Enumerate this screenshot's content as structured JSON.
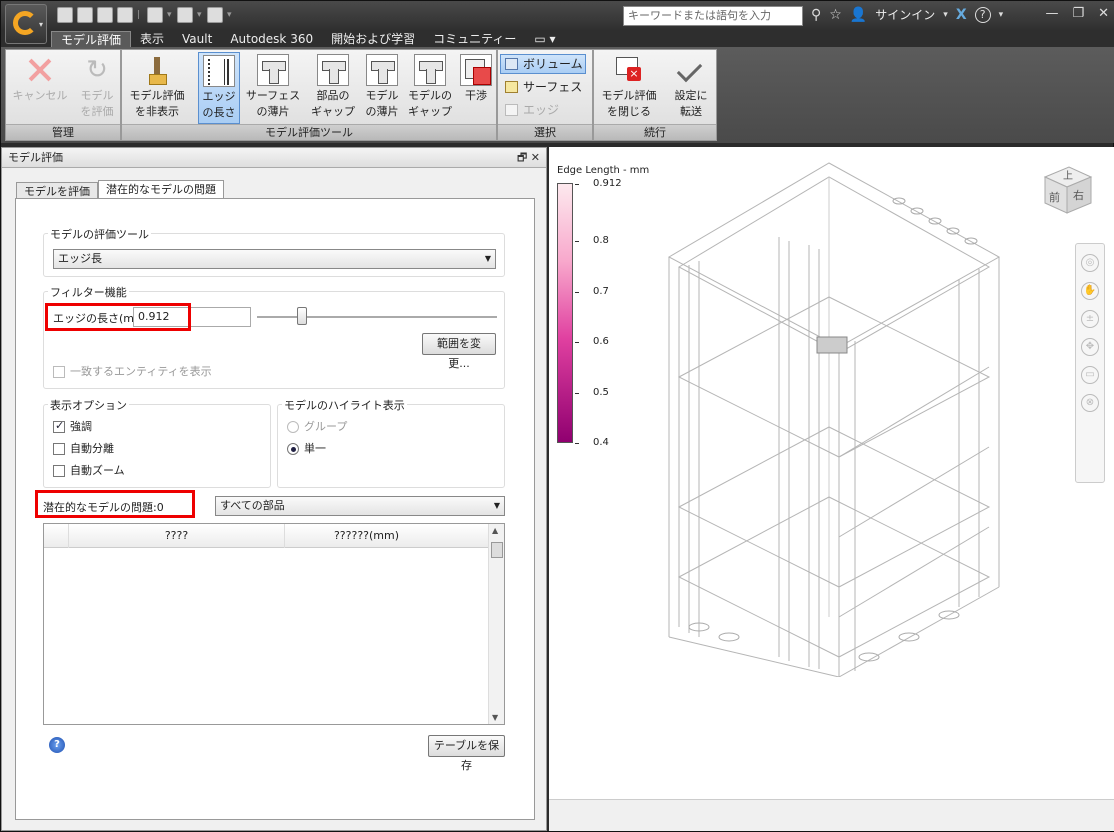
{
  "app": {
    "search_placeholder": "キーワードまたは語句を入力",
    "signin": "サインイン"
  },
  "tabs": [
    "モデル評価",
    "表示",
    "Vault",
    "Autodesk 360",
    "開始および学習",
    "コミュニティー"
  ],
  "ribbon": {
    "cancel": [
      "キャンセル"
    ],
    "eval_model": [
      "モデル",
      "を評価"
    ],
    "hide_eval": [
      "モデル評価",
      "を非表示"
    ],
    "edge_len": [
      "エッジ",
      "の長さ"
    ],
    "surf_slice": [
      "サーフェス",
      "の薄片"
    ],
    "part_gap": [
      "部品の",
      "ギャップ"
    ],
    "model_slice": [
      "モデル",
      "の薄片"
    ],
    "model_gap": [
      "モデルの",
      "ギャップ"
    ],
    "interference": [
      "干渉"
    ],
    "sel_volume": "ボリューム",
    "sel_surface": "サーフェス",
    "sel_edge": "エッジ",
    "close_eval": [
      "モデル評価",
      "を閉じる"
    ],
    "transfer": [
      "設定に",
      "転送"
    ],
    "panel_manage": "管理",
    "panel_tools": "モデル評価ツール",
    "panel_select": "選択",
    "panel_continue": "続行"
  },
  "panel": {
    "title": "モデル評価",
    "tab1": "モデルを評価",
    "tab2": "潜在的なモデルの問題",
    "tool_group": "モデルの評価ツール",
    "tool_value": "エッジ長",
    "filter_group": "フィルター機能",
    "edge_label": "エッジの長さ(mm)",
    "edge_value": "0.912",
    "change_range": "範囲を変更...",
    "show_matching": "一致するエンティティを表示",
    "display_group": "表示オプション",
    "emphasis": "強調",
    "auto_isolate": "自動分離",
    "auto_zoom": "自動ズーム",
    "highlight_group": "モデルのハイライト表示",
    "group_opt": "グループ",
    "single_opt": "単一",
    "issues_label": "潜在的なモデルの問題:",
    "issues_count": "0",
    "parts_filter": "すべての部品",
    "col1": "????",
    "col2": "??????(mm)",
    "save_table": "テーブルを保存"
  },
  "legend": {
    "title": "Edge Length - mm",
    "ticks": [
      "0.912",
      "0.8",
      "0.7",
      "0.6",
      "0.5",
      "0.4"
    ]
  },
  "viewcube": {
    "top": "上",
    "front": "前",
    "right": "右"
  }
}
